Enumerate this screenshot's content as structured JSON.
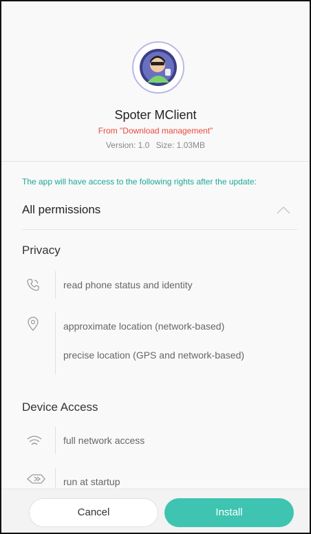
{
  "app": {
    "name": "Spoter MClient",
    "source": "From \"Download management\"",
    "version_label": "Version: 1.0",
    "size_label": "Size: 1.03MB"
  },
  "notice": "The app will have access to the following rights after the update:",
  "permissions": {
    "header": "All permissions",
    "sections": [
      {
        "title": "Privacy",
        "groups": [
          {
            "icon": "phone-icon",
            "items": [
              "read phone status and identity"
            ]
          },
          {
            "icon": "location-pin-icon",
            "items": [
              "approximate location (network-based)",
              "precise location (GPS and network-based)"
            ]
          }
        ]
      },
      {
        "title": "Device Access",
        "groups": [
          {
            "icon": "wifi-icon",
            "items": [
              "full network access"
            ]
          },
          {
            "icon": "startup-icon",
            "items": [
              "run at startup"
            ]
          }
        ]
      }
    ]
  },
  "footer": {
    "cancel_label": "Cancel",
    "install_label": "Install"
  },
  "colors": {
    "accent": "#3ec4b0",
    "source_red": "#e84a3c",
    "notice_teal": "#1aa896"
  }
}
